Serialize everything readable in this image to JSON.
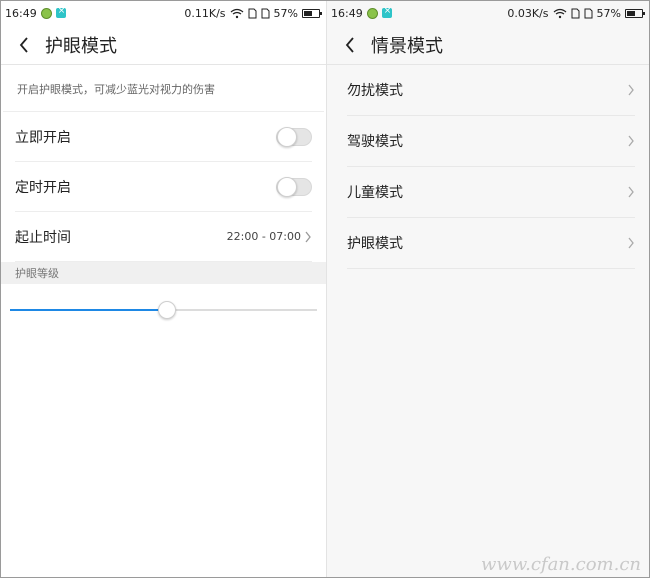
{
  "left": {
    "status": {
      "time": "16:49",
      "speed": "0.11K/s",
      "battery": "57%",
      "battery_level": 0.57
    },
    "title": "护眼模式",
    "description": "开启护眼模式，可减少蓝光对视力的伤害",
    "rows": [
      {
        "label": "立即开启",
        "on": false
      },
      {
        "label": "定时开启",
        "on": false
      }
    ],
    "time_range": {
      "label": "起止时间",
      "value": "22:00 - 07:00"
    },
    "section": "护眼等级",
    "level": 0.51
  },
  "right": {
    "status": {
      "time": "16:49",
      "speed": "0.03K/s",
      "battery": "57%",
      "battery_level": 0.57
    },
    "title": "情景模式",
    "items": [
      "勿扰模式",
      "驾驶模式",
      "儿童模式",
      "护眼模式"
    ]
  },
  "watermark": "www.cfan.com.cn",
  "colors": {
    "accent": "#1e88e5",
    "track": "#dcdcdc",
    "divider": "#ededed"
  },
  "icons": {
    "back": "chevron-left-icon",
    "chevron": "chevron-right-icon",
    "wifi": "wifi-icon",
    "battery": "battery-icon"
  }
}
